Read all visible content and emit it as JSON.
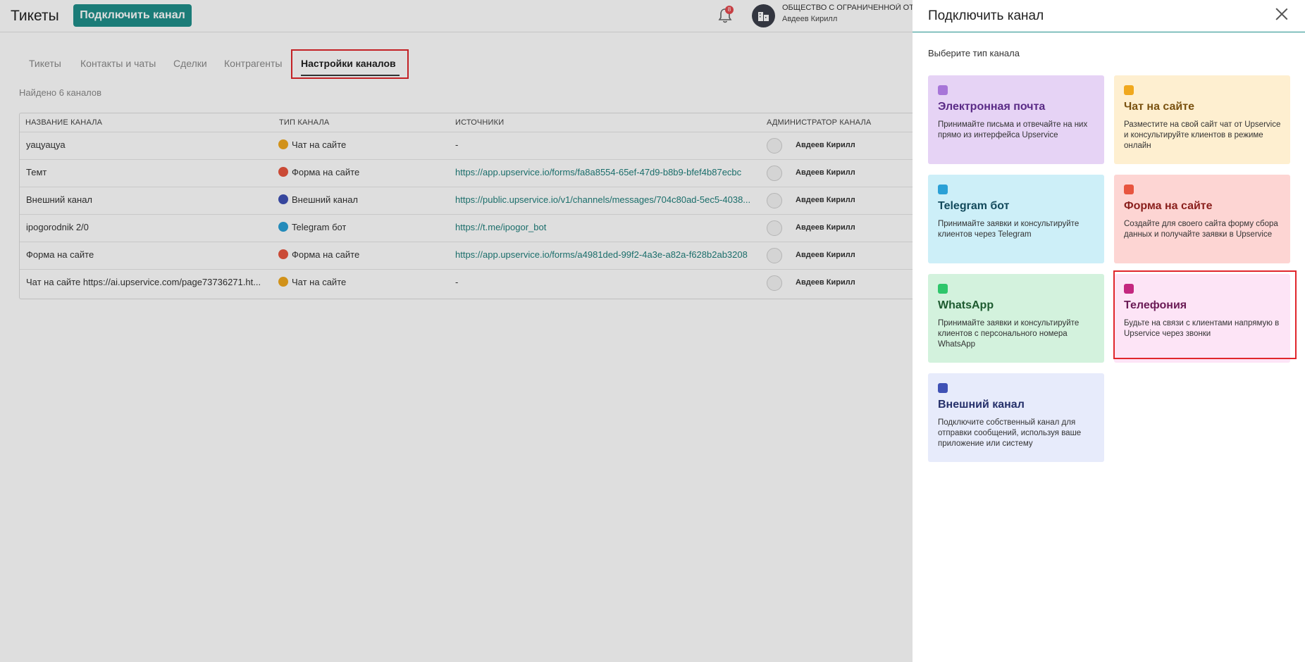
{
  "header": {
    "title": "Тикеты",
    "connect_button": "Подключить канал",
    "notifications_count": "8",
    "org_name": "ОБЩЕСТВО С ОГРАНИЧЕННОЙ ОТВ",
    "user_name": "Авдеев Кирилл"
  },
  "tabs": [
    {
      "label": "Тикеты",
      "active": false
    },
    {
      "label": "Контакты и чаты",
      "active": false
    },
    {
      "label": "Сделки",
      "active": false
    },
    {
      "label": "Контрагенты",
      "active": false
    },
    {
      "label": "Настройки каналов",
      "active": true
    }
  ],
  "found_text": "Найдено 6 каналов",
  "table": {
    "columns": [
      "НАЗВАНИЕ КАНАЛА",
      "ТИП КАНАЛА",
      "ИСТОЧНИКИ",
      "АДМИНИСТРАТОР КАНАЛА"
    ],
    "rows": [
      {
        "name": "уацуацуа",
        "type": "Чат на сайте",
        "type_icon": "chat-icon",
        "source": "-",
        "admin": "Авдеев Кирилл"
      },
      {
        "name": "Темт",
        "type": "Форма на сайте",
        "type_icon": "form-icon",
        "source": "https://app.upservice.io/forms/fa8a8554-65ef-47d9-b8b9-bfef4b87ecbc",
        "admin": "Авдеев Кирилл"
      },
      {
        "name": "Внешний канал",
        "type": "Внешний канал",
        "type_icon": "external-channel-icon",
        "source": "https://public.upservice.io/v1/channels/messages/704c80ad-5ec5-4038...",
        "admin": "Авдеев Кирилл"
      },
      {
        "name": "ipogorodnik 2/0",
        "type": "Telegram бот",
        "type_icon": "telegram-icon",
        "source": "https://t.me/ipogor_bot",
        "admin": "Авдеев Кирилл"
      },
      {
        "name": "Форма на сайте",
        "type": "Форма на сайте",
        "type_icon": "form-icon",
        "source": "https://app.upservice.io/forms/a4981ded-99f2-4a3e-a82a-f628b2ab3208",
        "admin": "Авдеев Кирилл"
      },
      {
        "name": "Чат на сайте https://ai.upservice.com/page73736271.ht...",
        "type": "Чат на сайте",
        "type_icon": "chat-icon",
        "source": "-",
        "admin": "Авдеев Кирилл"
      }
    ]
  },
  "panel": {
    "title": "Подключить канал",
    "subtitle": "Выберите тип канала",
    "cards": [
      {
        "title": "Электронная почта",
        "desc": "Принимайте письма и отвечайте на них прямо из интерфейса Upservice",
        "bg": "#e6d3f5",
        "title_color": "#5a2a86",
        "icon_color": "#a775d8",
        "icon": "email-icon"
      },
      {
        "title": "Чат на сайте",
        "desc": "Разместите на свой сайт чат от Upservice и консультируйте клиентов в режиме онлайн",
        "bg": "#feefd0",
        "title_color": "#7a5210",
        "icon_color": "#f0a81e",
        "icon": "chat-icon"
      },
      {
        "title": "Telegram бот",
        "desc": "Принимайте заявки и консультируйте клиентов через Telegram",
        "bg": "#cdeff8",
        "title_color": "#134a5c",
        "icon_color": "#2aa0d6",
        "icon": "telegram-icon"
      },
      {
        "title": "Форма на сайте",
        "desc": "Создайте для своего сайта форму сбора данных и получайте заявки в Upservice",
        "bg": "#fdd5d3",
        "title_color": "#8a1f1c",
        "icon_color": "#e8553f",
        "icon": "form-icon"
      },
      {
        "title": "WhatsApp",
        "desc": "Принимайте заявки и консультируйте клиентов с персонального номера WhatsApp",
        "bg": "#d3f2dd",
        "title_color": "#1d5a2f",
        "icon_color": "#2ec66b",
        "icon": "whatsapp-icon"
      },
      {
        "title": "Телефония",
        "desc": "Будьте на связи с клиентами напрямую в Upservice через звонки",
        "bg": "#fde4f6",
        "title_color": "#6a1a55",
        "icon_color": "#c4277f",
        "icon": "phone-icon"
      },
      {
        "title": "Внешний канал",
        "desc": "Подключите собственный канал для отправки сообщений, используя ваше приложение или систему",
        "bg": "#e7ebfb",
        "title_color": "#25306a",
        "icon_color": "#3f51b5",
        "icon": "external-channel-icon"
      }
    ]
  }
}
